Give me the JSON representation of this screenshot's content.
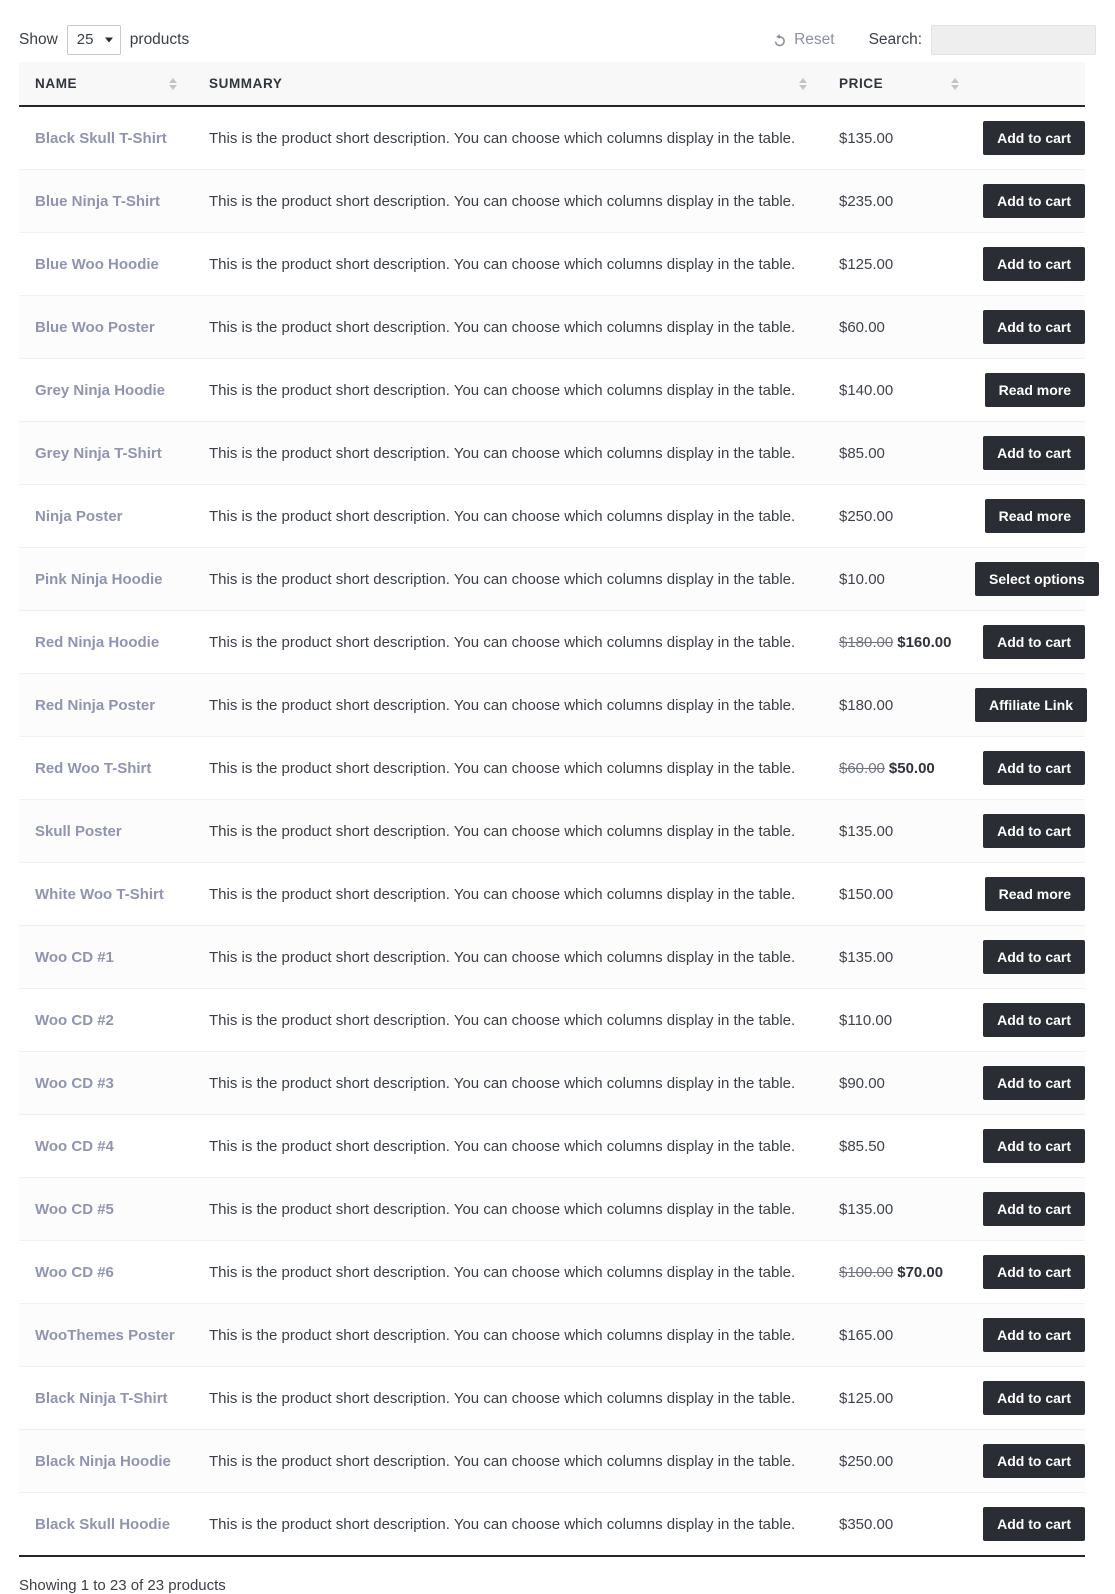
{
  "controls": {
    "show_label_before": "Show",
    "show_label_after": "products",
    "page_length_value": "25",
    "page_length_options": [
      "25"
    ],
    "reset_label": "Reset",
    "reset_icon": "undo-arrow-icon",
    "search_label": "Search:",
    "search_value": "",
    "search_placeholder": ""
  },
  "table": {
    "columns": [
      {
        "key": "name",
        "label": "NAME",
        "sortable": true
      },
      {
        "key": "summary",
        "label": "SUMMARY",
        "sortable": false
      },
      {
        "key": "price",
        "label": "PRICE",
        "sortable": true
      },
      {
        "key": "action",
        "label": "",
        "sortable": false
      }
    ],
    "shared_summary": "This is the product short description. You can choose which columns display in the table.",
    "rows": [
      {
        "name": "Black Skull T-Shirt",
        "summary": "This is the product short description. You can choose which columns display in the table.",
        "price": "$135.00",
        "price_old": "",
        "price_new": "",
        "button": "Add to cart"
      },
      {
        "name": "Blue Ninja T-Shirt",
        "summary": "This is the product short description. You can choose which columns display in the table.",
        "price": "$235.00",
        "price_old": "",
        "price_new": "",
        "button": "Add to cart"
      },
      {
        "name": "Blue Woo Hoodie",
        "summary": "This is the product short description. You can choose which columns display in the table.",
        "price": "$125.00",
        "price_old": "",
        "price_new": "",
        "button": "Add to cart"
      },
      {
        "name": "Blue Woo Poster",
        "summary": "This is the product short description. You can choose which columns display in the table.",
        "price": "$60.00",
        "price_old": "",
        "price_new": "",
        "button": "Add to cart"
      },
      {
        "name": "Grey Ninja Hoodie",
        "summary": "This is the product short description. You can choose which columns display in the table.",
        "price": "$140.00",
        "price_old": "",
        "price_new": "",
        "button": "Read more"
      },
      {
        "name": "Grey Ninja T-Shirt",
        "summary": "This is the product short description. You can choose which columns display in the table.",
        "price": "$85.00",
        "price_old": "",
        "price_new": "",
        "button": "Add to cart"
      },
      {
        "name": "Ninja Poster",
        "summary": "This is the product short description. You can choose which columns display in the table.",
        "price": "$250.00",
        "price_old": "",
        "price_new": "",
        "button": "Read more"
      },
      {
        "name": "Pink Ninja Hoodie",
        "summary": "This is the product short description. You can choose which columns display in the table.",
        "price": "$10.00",
        "price_old": "",
        "price_new": "",
        "button": "Select options"
      },
      {
        "name": "Red Ninja Hoodie",
        "summary": "This is the product short description. You can choose which columns display in the table.",
        "price": "",
        "price_old": "$180.00",
        "price_new": "$160.00",
        "button": "Add to cart"
      },
      {
        "name": "Red Ninja Poster",
        "summary": "This is the product short description. You can choose which columns display in the table.",
        "price": "$180.00",
        "price_old": "",
        "price_new": "",
        "button": "Affiliate Link"
      },
      {
        "name": "Red Woo T-Shirt",
        "summary": "This is the product short description. You can choose which columns display in the table.",
        "price": "",
        "price_old": "$60.00",
        "price_new": "$50.00",
        "button": "Add to cart"
      },
      {
        "name": "Skull Poster",
        "summary": "This is the product short description. You can choose which columns display in the table.",
        "price": "$135.00",
        "price_old": "",
        "price_new": "",
        "button": "Add to cart"
      },
      {
        "name": "White Woo T-Shirt",
        "summary": "This is the product short description. You can choose which columns display in the table.",
        "price": "$150.00",
        "price_old": "",
        "price_new": "",
        "button": "Read more"
      },
      {
        "name": "Woo CD #1",
        "summary": "This is the product short description. You can choose which columns display in the table.",
        "price": "$135.00",
        "price_old": "",
        "price_new": "",
        "button": "Add to cart"
      },
      {
        "name": "Woo CD #2",
        "summary": "This is the product short description. You can choose which columns display in the table.",
        "price": "$110.00",
        "price_old": "",
        "price_new": "",
        "button": "Add to cart"
      },
      {
        "name": "Woo CD #3",
        "summary": "This is the product short description. You can choose which columns display in the table.",
        "price": "$90.00",
        "price_old": "",
        "price_new": "",
        "button": "Add to cart"
      },
      {
        "name": "Woo CD #4",
        "summary": "This is the product short description. You can choose which columns display in the table.",
        "price": "$85.50",
        "price_old": "",
        "price_new": "",
        "button": "Add to cart"
      },
      {
        "name": "Woo CD #5",
        "summary": "This is the product short description. You can choose which columns display in the table.",
        "price": "$135.00",
        "price_old": "",
        "price_new": "",
        "button": "Add to cart"
      },
      {
        "name": "Woo CD #6",
        "summary": "This is the product short description. You can choose which columns display in the table.",
        "price": "",
        "price_old": "$100.00",
        "price_new": "$70.00",
        "button": "Add to cart"
      },
      {
        "name": "WooThemes Poster",
        "summary": "This is the product short description. You can choose which columns display in the table.",
        "price": "$165.00",
        "price_old": "",
        "price_new": "",
        "button": "Add to cart"
      },
      {
        "name": "Black Ninja T-Shirt",
        "summary": "This is the product short description. You can choose which columns display in the table.",
        "price": "$125.00",
        "price_old": "",
        "price_new": "",
        "button": "Add to cart"
      },
      {
        "name": "Black Ninja Hoodie",
        "summary": "This is the product short description. You can choose which columns display in the table.",
        "price": "$250.00",
        "price_old": "",
        "price_new": "",
        "button": "Add to cart"
      },
      {
        "name": "Black Skull Hoodie",
        "summary": "This is the product short description. You can choose which columns display in the table.",
        "price": "$350.00",
        "price_old": "",
        "price_new": "",
        "button": "Add to cart"
      }
    ]
  },
  "footer": {
    "info": "Showing 1 to 23 of 23 products"
  },
  "colors": {
    "button_bg": "#2a2d33",
    "product_link": "#9094b0",
    "header_bg": "#f8f8f8",
    "header_rule": "#23262b",
    "reset_text": "#8d8fa8"
  }
}
